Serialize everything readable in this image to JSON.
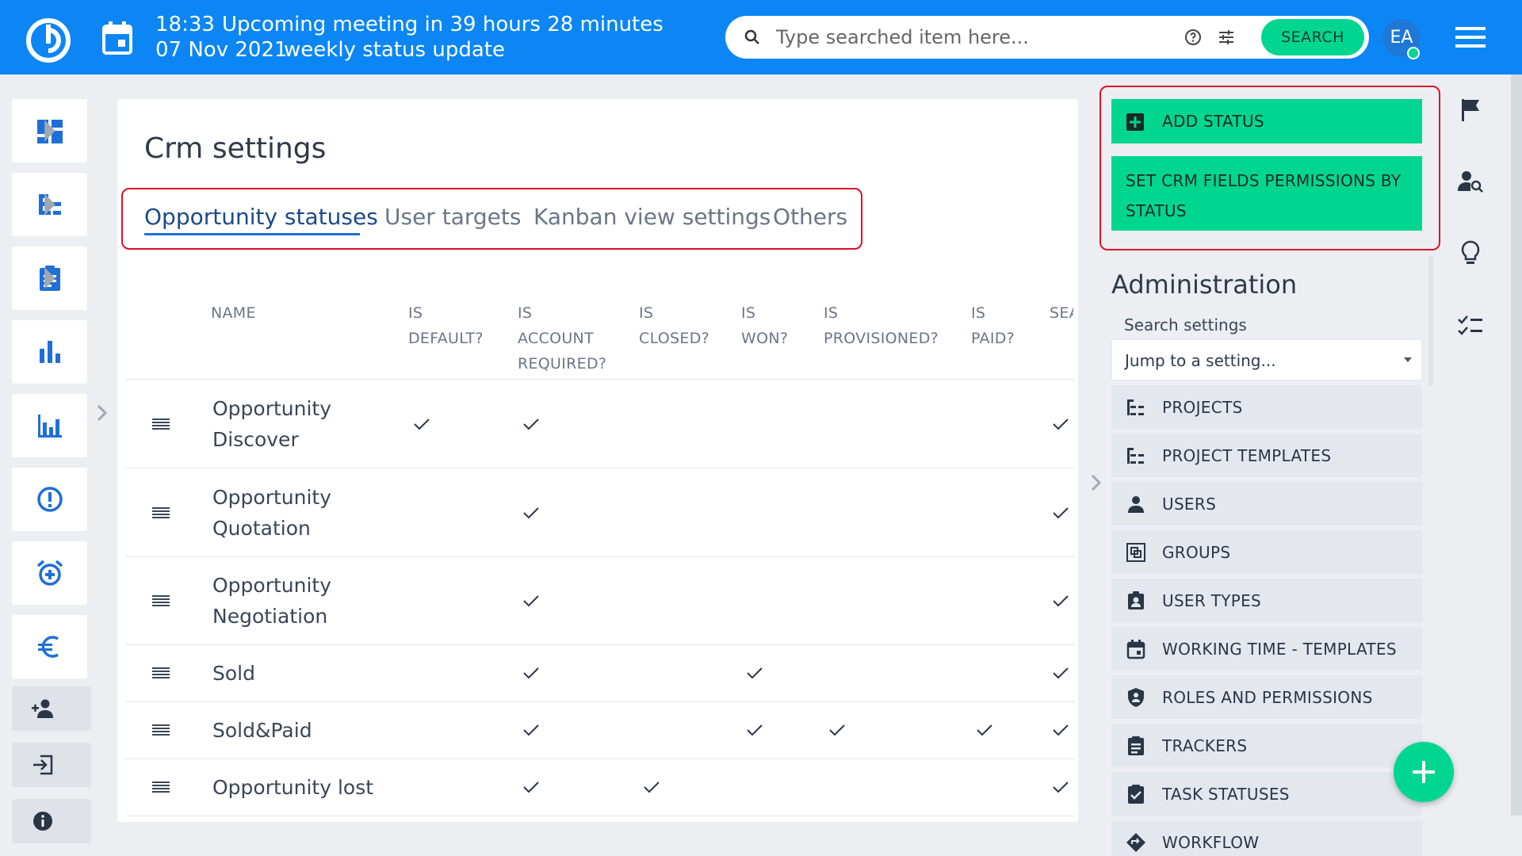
{
  "topbar": {
    "meeting_time": "18:33",
    "meeting_date": "07 Nov 2021",
    "meeting_title": "Upcoming meeting in 39 hours 28 minutes",
    "meeting_subtitle": "weekly status update",
    "search_placeholder": "Type searched item here...",
    "search_button": "SEARCH",
    "avatar_initials": "EA"
  },
  "main": {
    "title": "Crm settings",
    "tabs": [
      {
        "label": "Opportunity statuses",
        "active": true
      },
      {
        "label": "User targets"
      },
      {
        "label": "Kanban view settings"
      },
      {
        "label": "Others"
      }
    ],
    "columns": [
      {
        "line1": "NAME",
        "line2": "",
        "line3": ""
      },
      {
        "line1": "IS",
        "line2": "DEFAULT?",
        "line3": ""
      },
      {
        "line1": "IS",
        "line2": "ACCOUNT",
        "line3": "REQUIRED?"
      },
      {
        "line1": "IS",
        "line2": "CLOSED?",
        "line3": ""
      },
      {
        "line1": "IS",
        "line2": "WON?",
        "line3": ""
      },
      {
        "line1": "IS",
        "line2": "PROVISIONED?",
        "line3": ""
      },
      {
        "line1": "IS",
        "line2": "PAID?",
        "line3": ""
      },
      {
        "line1": "SEA",
        "line2": "",
        "line3": ""
      }
    ],
    "rows": [
      {
        "name1": "Opportunity",
        "name2": "Discover",
        "default": true,
        "account": true,
        "closed": false,
        "won": false,
        "provisioned": false,
        "paid": false,
        "last": true
      },
      {
        "name1": "Opportunity",
        "name2": "Quotation",
        "default": false,
        "account": true,
        "closed": false,
        "won": false,
        "provisioned": false,
        "paid": false,
        "last": true
      },
      {
        "name1": "Opportunity",
        "name2": "Negotiation",
        "default": false,
        "account": true,
        "closed": false,
        "won": false,
        "provisioned": false,
        "paid": false,
        "last": true
      },
      {
        "name1": "Sold",
        "name2": "",
        "default": false,
        "account": true,
        "closed": false,
        "won": true,
        "provisioned": false,
        "paid": false,
        "last": true
      },
      {
        "name1": "Sold&Paid",
        "name2": "",
        "default": false,
        "account": true,
        "closed": false,
        "won": true,
        "provisioned": true,
        "paid": true,
        "last": true
      },
      {
        "name1": "Opportunity lost",
        "name2": "",
        "default": false,
        "account": true,
        "closed": true,
        "won": false,
        "provisioned": false,
        "paid": false,
        "last": true
      }
    ]
  },
  "right_panel": {
    "add_status": "ADD STATUS",
    "set_permissions": "SET CRM FIELDS PERMISSIONS BY STATUS",
    "admin_title": "Administration",
    "search_settings_label": "Search settings",
    "jump_placeholder": "Jump to a setting...",
    "menu": [
      {
        "label": "PROJECTS",
        "icon": "project-tree-icon"
      },
      {
        "label": "PROJECT TEMPLATES",
        "icon": "project-tree-icon"
      },
      {
        "label": "USERS",
        "icon": "user-icon"
      },
      {
        "label": "GROUPS",
        "icon": "groups-icon"
      },
      {
        "label": "USER TYPES",
        "icon": "user-badge-icon"
      },
      {
        "label": "WORKING TIME - TEMPLATES",
        "icon": "calendar-icon"
      },
      {
        "label": "ROLES AND PERMISSIONS",
        "icon": "shield-user-icon"
      },
      {
        "label": "TRACKERS",
        "icon": "clipboard-icon"
      },
      {
        "label": "TASK STATUSES",
        "icon": "clipboard-check-icon"
      },
      {
        "label": "WORKFLOW",
        "icon": "workflow-icon"
      }
    ]
  },
  "colors": {
    "brand_blue": "#0c86f5",
    "accent_green": "#00d690",
    "highlight_red": "#e0102a"
  }
}
